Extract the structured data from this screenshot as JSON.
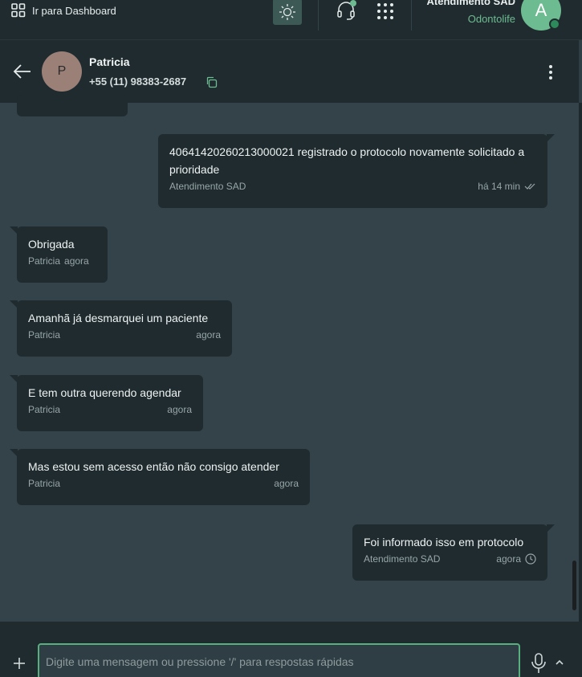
{
  "topbar": {
    "dashboard_label": "Ir para Dashboard",
    "agent_name": "Atendimento SAD",
    "agent_org": "Odontolife",
    "agent_initial": "A"
  },
  "contact": {
    "initial": "P",
    "name": "Patricia",
    "phone": "+55 (11) 98383-2687"
  },
  "messages": [
    {
      "dir": "out",
      "text": "40641420260213000021 registrado o protocolo novamente solicitado a prioridade",
      "sender": "Atendimento SAD",
      "time": "há 14 min",
      "status": "read-double-check-icon"
    },
    {
      "dir": "in",
      "text": "Obrigada",
      "sender": "Patricia",
      "time": "agora"
    },
    {
      "dir": "in",
      "text": "Amanhã já desmarquei um paciente",
      "sender": "Patricia",
      "time": "agora"
    },
    {
      "dir": "in",
      "text": "E tem outra querendo agendar",
      "sender": "Patricia",
      "time": "agora"
    },
    {
      "dir": "in",
      "text": "Mas estou sem acesso então não consigo atender",
      "sender": "Patricia",
      "time": "agora"
    },
    {
      "dir": "out",
      "text": "Foi informado isso em protocolo",
      "sender": "Atendimento SAD",
      "time": "agora",
      "status": "pending-clock-icon"
    }
  ],
  "composer": {
    "placeholder": "Digite uma mensagem ou pressione '/' para respostas rápidas"
  },
  "colors": {
    "accent": "#6dbb90",
    "bubble": "#1f2b2f",
    "chat_bg": "#344349"
  }
}
